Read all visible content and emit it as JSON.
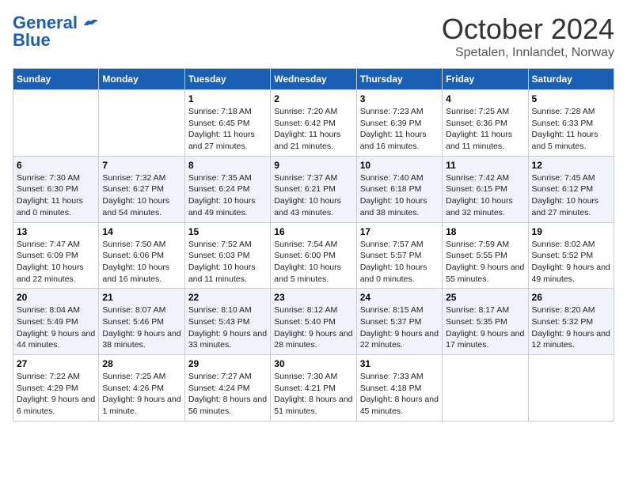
{
  "logo": {
    "line1": "General",
    "line2": "Blue"
  },
  "title": "October 2024",
  "location": "Spetalen, Innlandet, Norway",
  "days_header": [
    "Sunday",
    "Monday",
    "Tuesday",
    "Wednesday",
    "Thursday",
    "Friday",
    "Saturday"
  ],
  "weeks": [
    [
      {
        "day": "",
        "info": ""
      },
      {
        "day": "",
        "info": ""
      },
      {
        "day": "1",
        "info": "Sunrise: 7:18 AM\nSunset: 6:45 PM\nDaylight: 11 hours and 27 minutes."
      },
      {
        "day": "2",
        "info": "Sunrise: 7:20 AM\nSunset: 6:42 PM\nDaylight: 11 hours and 21 minutes."
      },
      {
        "day": "3",
        "info": "Sunrise: 7:23 AM\nSunset: 6:39 PM\nDaylight: 11 hours and 16 minutes."
      },
      {
        "day": "4",
        "info": "Sunrise: 7:25 AM\nSunset: 6:36 PM\nDaylight: 11 hours and 11 minutes."
      },
      {
        "day": "5",
        "info": "Sunrise: 7:28 AM\nSunset: 6:33 PM\nDaylight: 11 hours and 5 minutes."
      }
    ],
    [
      {
        "day": "6",
        "info": "Sunrise: 7:30 AM\nSunset: 6:30 PM\nDaylight: 11 hours and 0 minutes."
      },
      {
        "day": "7",
        "info": "Sunrise: 7:32 AM\nSunset: 6:27 PM\nDaylight: 10 hours and 54 minutes."
      },
      {
        "day": "8",
        "info": "Sunrise: 7:35 AM\nSunset: 6:24 PM\nDaylight: 10 hours and 49 minutes."
      },
      {
        "day": "9",
        "info": "Sunrise: 7:37 AM\nSunset: 6:21 PM\nDaylight: 10 hours and 43 minutes."
      },
      {
        "day": "10",
        "info": "Sunrise: 7:40 AM\nSunset: 6:18 PM\nDaylight: 10 hours and 38 minutes."
      },
      {
        "day": "11",
        "info": "Sunrise: 7:42 AM\nSunset: 6:15 PM\nDaylight: 10 hours and 32 minutes."
      },
      {
        "day": "12",
        "info": "Sunrise: 7:45 AM\nSunset: 6:12 PM\nDaylight: 10 hours and 27 minutes."
      }
    ],
    [
      {
        "day": "13",
        "info": "Sunrise: 7:47 AM\nSunset: 6:09 PM\nDaylight: 10 hours and 22 minutes."
      },
      {
        "day": "14",
        "info": "Sunrise: 7:50 AM\nSunset: 6:06 PM\nDaylight: 10 hours and 16 minutes."
      },
      {
        "day": "15",
        "info": "Sunrise: 7:52 AM\nSunset: 6:03 PM\nDaylight: 10 hours and 11 minutes."
      },
      {
        "day": "16",
        "info": "Sunrise: 7:54 AM\nSunset: 6:00 PM\nDaylight: 10 hours and 5 minutes."
      },
      {
        "day": "17",
        "info": "Sunrise: 7:57 AM\nSunset: 5:57 PM\nDaylight: 10 hours and 0 minutes."
      },
      {
        "day": "18",
        "info": "Sunrise: 7:59 AM\nSunset: 5:55 PM\nDaylight: 9 hours and 55 minutes."
      },
      {
        "day": "19",
        "info": "Sunrise: 8:02 AM\nSunset: 5:52 PM\nDaylight: 9 hours and 49 minutes."
      }
    ],
    [
      {
        "day": "20",
        "info": "Sunrise: 8:04 AM\nSunset: 5:49 PM\nDaylight: 9 hours and 44 minutes."
      },
      {
        "day": "21",
        "info": "Sunrise: 8:07 AM\nSunset: 5:46 PM\nDaylight: 9 hours and 38 minutes."
      },
      {
        "day": "22",
        "info": "Sunrise: 8:10 AM\nSunset: 5:43 PM\nDaylight: 9 hours and 33 minutes."
      },
      {
        "day": "23",
        "info": "Sunrise: 8:12 AM\nSunset: 5:40 PM\nDaylight: 9 hours and 28 minutes."
      },
      {
        "day": "24",
        "info": "Sunrise: 8:15 AM\nSunset: 5:37 PM\nDaylight: 9 hours and 22 minutes."
      },
      {
        "day": "25",
        "info": "Sunrise: 8:17 AM\nSunset: 5:35 PM\nDaylight: 9 hours and 17 minutes."
      },
      {
        "day": "26",
        "info": "Sunrise: 8:20 AM\nSunset: 5:32 PM\nDaylight: 9 hours and 12 minutes."
      }
    ],
    [
      {
        "day": "27",
        "info": "Sunrise: 7:22 AM\nSunset: 4:29 PM\nDaylight: 9 hours and 6 minutes."
      },
      {
        "day": "28",
        "info": "Sunrise: 7:25 AM\nSunset: 4:26 PM\nDaylight: 9 hours and 1 minute."
      },
      {
        "day": "29",
        "info": "Sunrise: 7:27 AM\nSunset: 4:24 PM\nDaylight: 8 hours and 56 minutes."
      },
      {
        "day": "30",
        "info": "Sunrise: 7:30 AM\nSunset: 4:21 PM\nDaylight: 8 hours and 51 minutes."
      },
      {
        "day": "31",
        "info": "Sunrise: 7:33 AM\nSunset: 4:18 PM\nDaylight: 8 hours and 45 minutes."
      },
      {
        "day": "",
        "info": ""
      },
      {
        "day": "",
        "info": ""
      }
    ]
  ]
}
